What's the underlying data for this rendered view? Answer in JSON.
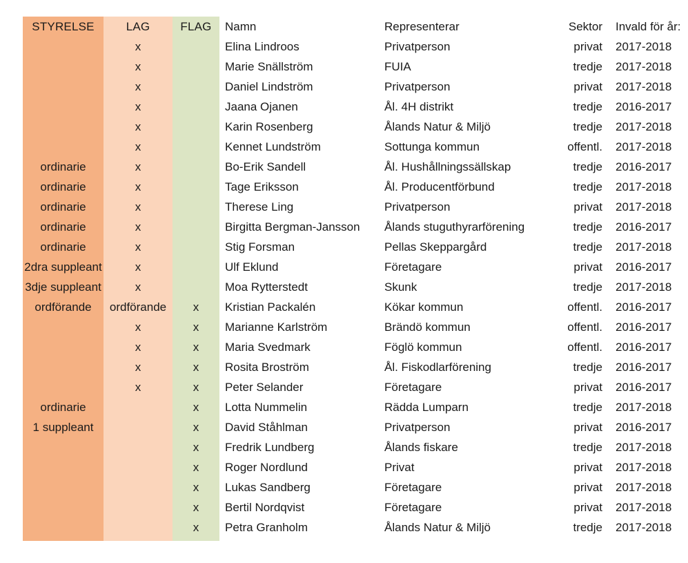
{
  "table": {
    "headers": {
      "styrelse": "STYRELSE",
      "lag": "LAG",
      "flag": "FLAG",
      "namn": "Namn",
      "representerar": "Representerar",
      "sektor": "Sektor",
      "invald": "Invald för år:"
    },
    "mark_symbol": "x",
    "colors": {
      "styrelse_band": "#F5B183",
      "lag_band": "#FBD5BB",
      "flag_band": "#DCE5C4",
      "text": "#1A1A1A",
      "muted_text": "#A6A6A6",
      "page_background": "#FFFFFF"
    },
    "rows": [
      {
        "styrelse": "",
        "lag": "x",
        "flag": "",
        "namn": "Elina Lindroos",
        "representerar": "Privatperson",
        "sektor": "privat",
        "invald": "2017-2018"
      },
      {
        "styrelse": "",
        "lag": "x",
        "flag": "",
        "namn": "Marie Snällström",
        "representerar": "FUIA",
        "sektor": "tredje",
        "invald": "2017-2018"
      },
      {
        "styrelse": "",
        "lag": "x",
        "flag": "",
        "namn": "Daniel Lindström",
        "representerar": "Privatperson",
        "sektor": "privat",
        "invald": "2017-2018"
      },
      {
        "styrelse": "",
        "lag": "x",
        "flag": "",
        "namn": "Jaana Ojanen",
        "representerar": "Ål. 4H distrikt",
        "sektor": "tredje",
        "invald": "2016-2017"
      },
      {
        "styrelse": "",
        "lag": "x",
        "flag": "",
        "namn": "Karin Rosenberg",
        "representerar": "Ålands Natur & Miljö",
        "sektor": "tredje",
        "invald": "2017-2018"
      },
      {
        "styrelse": "",
        "lag": "x",
        "flag": "",
        "namn": "Kennet Lundström",
        "representerar": "Sottunga kommun",
        "sektor": "offentl.",
        "invald": "2017-2018"
      },
      {
        "styrelse": "ordinarie",
        "lag": "x",
        "flag": "",
        "namn": "Bo-Erik Sandell",
        "representerar": "Ål. Hushållningssällskap",
        "sektor": "tredje",
        "invald": "2016-2017"
      },
      {
        "styrelse": "ordinarie",
        "lag": "x",
        "flag": "",
        "namn": "Tage Eriksson",
        "representerar": "Ål. Producentförbund",
        "sektor": "tredje",
        "invald": "2017-2018"
      },
      {
        "styrelse": "ordinarie",
        "lag": "x",
        "flag": "",
        "namn": "Therese Ling",
        "representerar": "Privatperson",
        "sektor": "privat",
        "invald": "2017-2018"
      },
      {
        "styrelse": "ordinarie",
        "lag": "x",
        "flag": "",
        "namn": "Birgitta Bergman-Jansson",
        "representerar": "Ålands stuguthyrarförening",
        "sektor": "tredje",
        "invald": "2016-2017"
      },
      {
        "styrelse": "ordinarie",
        "lag": "x",
        "flag": "",
        "namn": "Stig Forsman",
        "representerar": "Pellas Skeppargård",
        "sektor": "tredje",
        "invald": "2017-2018"
      },
      {
        "styrelse": "2dra suppleant",
        "lag": "x",
        "flag": "",
        "namn": "Ulf Eklund",
        "representerar": "Företagare",
        "sektor": "privat",
        "invald": "2016-2017"
      },
      {
        "styrelse": "3dje suppleant",
        "lag": "x",
        "flag": "",
        "namn": "Moa Rytterstedt",
        "representerar": "Skunk",
        "sektor": "tredje",
        "invald": "2017-2018"
      },
      {
        "styrelse": "ordförande",
        "lag": "ordförande",
        "flag": "x",
        "namn": "Kristian Packalén",
        "representerar": "Kökar kommun",
        "sektor": "offentl.",
        "invald": "2016-2017"
      },
      {
        "styrelse": "",
        "lag": "x",
        "flag": "x",
        "namn": "Marianne Karlström",
        "representerar": "Brändö kommun",
        "sektor": "offentl.",
        "invald": "2016-2017"
      },
      {
        "styrelse": "",
        "lag": "x",
        "flag": "x",
        "namn": "Maria Svedmark",
        "representerar": "Föglö kommun",
        "sektor": "offentl.",
        "invald": "2016-2017"
      },
      {
        "styrelse": "",
        "lag": "x",
        "flag": "x",
        "namn": "Rosita Broström",
        "representerar": "Ål. Fiskodlarförening",
        "sektor": "tredje",
        "invald": "2016-2017"
      },
      {
        "styrelse": "",
        "lag": "x",
        "flag": "x",
        "namn": "Peter Selander",
        "representerar": "Företagare",
        "sektor": "privat",
        "invald": "2016-2017"
      },
      {
        "styrelse": "ordinarie",
        "lag": "",
        "flag": "x",
        "namn": "Lotta Nummelin",
        "representerar": "Rädda Lumparn",
        "sektor": "tredje",
        "invald": "2017-2018"
      },
      {
        "styrelse": "1 suppleant",
        "lag": "",
        "flag": "x",
        "namn": "David Ståhlman",
        "representerar": "Privatperson",
        "sektor": "privat",
        "invald": "2016-2017"
      },
      {
        "styrelse": "",
        "lag": "",
        "flag": "x",
        "namn": "Fredrik Lundberg",
        "representerar": "Ålands fiskare",
        "sektor": "tredje",
        "invald": "2017-2018"
      },
      {
        "styrelse": "",
        "lag": "",
        "flag": "x",
        "namn": "Roger Nordlund",
        "representerar": "Privat",
        "sektor": "privat",
        "invald": "2017-2018"
      },
      {
        "styrelse": "",
        "lag": "",
        "flag": "x",
        "namn": "Lukas Sandberg",
        "representerar": "Företagare",
        "sektor": "privat",
        "invald": "2017-2018"
      },
      {
        "styrelse": "",
        "lag": "",
        "flag": "x",
        "namn": "Bertil Nordqvist",
        "representerar": "Företagare",
        "sektor": "privat",
        "invald": "2017-2018"
      },
      {
        "styrelse": "",
        "lag": "",
        "flag": "x",
        "namn": "Petra Granholm",
        "representerar": "Ålands Natur & Miljö",
        "sektor": "tredje",
        "invald": "2017-2018"
      }
    ]
  }
}
